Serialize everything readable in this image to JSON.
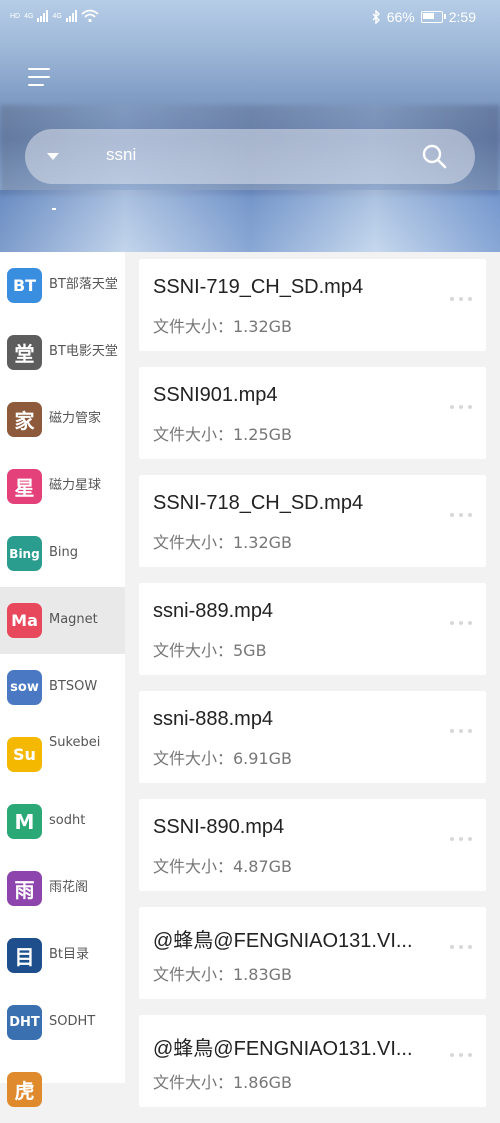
{
  "status": {
    "left_mini": "HD",
    "sig1": "4G",
    "sig2": "4G",
    "battery_percent": "66%",
    "battery_level": 0.66,
    "time": "2:59"
  },
  "search": {
    "query": "ssni"
  },
  "sidebar": {
    "items": [
      {
        "icon_text": "BT",
        "label": "BT部落天堂",
        "color": "#3a8ee0",
        "icon": "bt-tribe-icon"
      },
      {
        "icon_text": "堂",
        "label": "BT电影天堂",
        "color": "#5d5d5d",
        "icon": "bt-movie-icon"
      },
      {
        "icon_text": "家",
        "label": "磁力管家",
        "color": "#8e5a3c",
        "icon": "magnet-butler-icon"
      },
      {
        "icon_text": "星",
        "label": "磁力星球",
        "color": "#e4407a",
        "icon": "magnet-planet-icon"
      },
      {
        "icon_text": "Bing",
        "label": "Bing",
        "color": "#2a9d8f",
        "icon": "bing-icon"
      },
      {
        "icon_text": "Ma",
        "label": "Magnet",
        "color": "#e8485b",
        "icon": "magnet-icon",
        "active": true
      },
      {
        "icon_text": "sow",
        "label": "BTSOW",
        "color": "#4a78c2",
        "icon": "btsow-icon"
      },
      {
        "icon_text": "Su",
        "label": "Sukebei",
        "color": "#f5b800",
        "icon": "sukebei-icon"
      },
      {
        "icon_text": "M",
        "label": "sodht",
        "color": "#2aa876",
        "icon": "sodht-icon"
      },
      {
        "icon_text": "雨",
        "label": "雨花阁",
        "color": "#8e44ad",
        "icon": "yuhuage-icon"
      },
      {
        "icon_text": "目",
        "label": "Bt目录",
        "color": "#1f4e8c",
        "icon": "bt-catalog-icon"
      },
      {
        "icon_text": "DHT",
        "label": "SODHT",
        "color": "#3a6fb0",
        "icon": "sodht-dht-icon"
      },
      {
        "icon_text": "虎",
        "label": "",
        "color": "#e08a2e",
        "icon": "partial-icon"
      }
    ]
  },
  "results": [
    {
      "name": "SSNI-719_CH_SD.mp4",
      "size": "文件大小：1.32GB"
    },
    {
      "name": "SSNI901.mp4",
      "size": "文件大小：1.25GB"
    },
    {
      "name": "SSNI-718_CH_SD.mp4",
      "size": "文件大小：1.32GB"
    },
    {
      "name": "ssni-889.mp4",
      "size": "文件大小：5GB"
    },
    {
      "name": "ssni-888.mp4",
      "size": "文件大小：6.91GB"
    },
    {
      "name": "SSNI-890.mp4",
      "size": "文件大小：4.87GB"
    },
    {
      "name": "@蜂鳥@FENGNIAO131.VI...",
      "size": "文件大小：1.83GB"
    },
    {
      "name": "@蜂鳥@FENGNIAO131.VI...",
      "size": "文件大小：1.86GB"
    }
  ]
}
